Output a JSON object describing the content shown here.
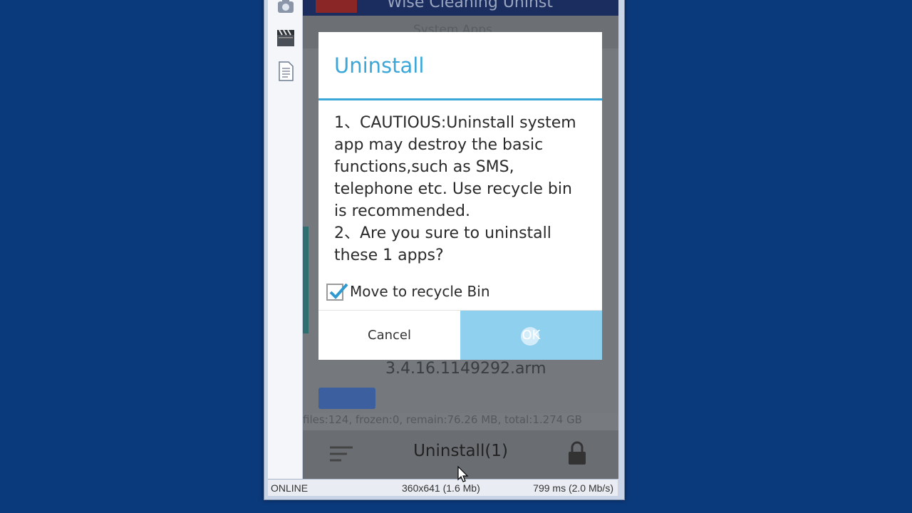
{
  "app": {
    "header_title": "Wise Cleaning Uninst",
    "tab_label": "System Apps"
  },
  "list": {
    "version_text": "3.4.16.1149292.arm",
    "stats": "files:124, frozen:0, remain:76.26 MB, total:1.274 GB"
  },
  "bottom_bar": {
    "uninstall_label": "Uninstall(1)"
  },
  "dialog": {
    "title": "Uninstall",
    "message_lines": [
      "1、CAUTIOUS:Uninstall system",
      "app may destroy the basic",
      "functions,such as SMS,",
      "telephone etc. Use recycle bin",
      "is recommended.",
      "2、Are you sure to uninstall",
      "these 1 apps?"
    ],
    "checkbox_label": "Move to recycle Bin",
    "checkbox_checked": true,
    "cancel_label": "Cancel",
    "ok_label": "OK"
  },
  "emulator_status": {
    "connection": "ONLINE",
    "resolution": "360x641 (1.6 Mb)",
    "latency": "799 ms (2.0 Mb/s)"
  },
  "colors": {
    "desktop_bg": "#0b3a7c",
    "dialog_accent": "#3aa7d8",
    "ok_button_bg": "#8fd0ef"
  },
  "icons": [
    "camera-icon",
    "clapperboard-icon",
    "document-icon",
    "sort-icon",
    "lock-icon",
    "checkmark-icon",
    "mouse-cursor-icon"
  ]
}
